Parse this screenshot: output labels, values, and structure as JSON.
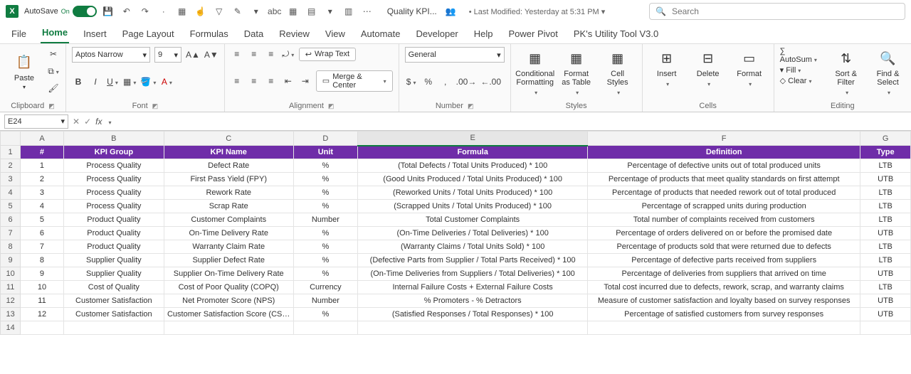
{
  "title": {
    "autosave_label": "AutoSave",
    "autosave_state": "On",
    "doc_name": "Quality KPI...",
    "modified": "• Last Modified: Yesterday at 5:31 PM",
    "search_placeholder": "Search"
  },
  "tabs": {
    "file": "File",
    "home": "Home",
    "insert": "Insert",
    "page_layout": "Page Layout",
    "formulas": "Formulas",
    "data": "Data",
    "review": "Review",
    "view": "View",
    "automate": "Automate",
    "developer": "Developer",
    "help": "Help",
    "power_pivot": "Power Pivot",
    "pk_util": "PK's Utility Tool V3.0"
  },
  "ribbon": {
    "clipboard": {
      "paste": "Paste",
      "label": "Clipboard"
    },
    "font": {
      "name": "Aptos Narrow",
      "size": "9",
      "label": "Font"
    },
    "alignment": {
      "wrap": "Wrap Text",
      "merge": "Merge & Center",
      "label": "Alignment"
    },
    "number": {
      "format": "General",
      "label": "Number"
    },
    "styles": {
      "cond": "Conditional Formatting",
      "table": "Format as Table",
      "cell": "Cell Styles",
      "label": "Styles"
    },
    "cells": {
      "insert": "Insert",
      "delete": "Delete",
      "format": "Format",
      "label": "Cells"
    },
    "editing": {
      "autosum": "AutoSum",
      "fill": "Fill",
      "clear": "Clear",
      "sort": "Sort & Filter",
      "find": "Find & Select",
      "label": "Editing"
    }
  },
  "formula_bar": {
    "name_box": "E24"
  },
  "grid": {
    "columns": [
      "A",
      "B",
      "C",
      "D",
      "E",
      "F",
      "G"
    ],
    "header_row": {
      "A": "#",
      "B": "KPI Group",
      "C": "KPI Name",
      "D": "Unit",
      "E": "Formula",
      "F": "Definition",
      "G": "Type"
    },
    "rows": [
      {
        "n": "1",
        "A": "1",
        "B": "Process Quality",
        "C": "Defect Rate",
        "D": "%",
        "E": "(Total Defects / Total Units Produced) * 100",
        "F": "Percentage of defective units out of total produced units",
        "G": "LTB"
      },
      {
        "n": "2",
        "A": "2",
        "B": "Process Quality",
        "C": "First Pass Yield (FPY)",
        "D": "%",
        "E": "(Good Units Produced / Total Units Produced) * 100",
        "F": "Percentage of products that meet quality standards on first attempt",
        "G": "UTB"
      },
      {
        "n": "3",
        "A": "3",
        "B": "Process Quality",
        "C": "Rework Rate",
        "D": "%",
        "E": "(Reworked Units / Total Units Produced) * 100",
        "F": "Percentage of products that needed rework out of total produced",
        "G": "LTB"
      },
      {
        "n": "4",
        "A": "4",
        "B": "Process Quality",
        "C": "Scrap Rate",
        "D": "%",
        "E": "(Scrapped Units / Total Units Produced) * 100",
        "F": "Percentage of scrapped units during production",
        "G": "LTB"
      },
      {
        "n": "5",
        "A": "5",
        "B": "Product Quality",
        "C": "Customer Complaints",
        "D": "Number",
        "E": "Total Customer Complaints",
        "F": "Total number of complaints received from customers",
        "G": "LTB"
      },
      {
        "n": "6",
        "A": "6",
        "B": "Product Quality",
        "C": "On-Time Delivery Rate",
        "D": "%",
        "E": "(On-Time Deliveries / Total Deliveries) * 100",
        "F": "Percentage of orders delivered on or before the promised date",
        "G": "UTB"
      },
      {
        "n": "7",
        "A": "7",
        "B": "Product Quality",
        "C": "Warranty Claim Rate",
        "D": "%",
        "E": "(Warranty Claims / Total Units Sold) * 100",
        "F": "Percentage of products sold that were returned due to defects",
        "G": "LTB"
      },
      {
        "n": "8",
        "A": "8",
        "B": "Supplier Quality",
        "C": "Supplier Defect Rate",
        "D": "%",
        "E": "(Defective Parts from Supplier / Total Parts Received) * 100",
        "F": "Percentage of defective parts received from suppliers",
        "G": "LTB"
      },
      {
        "n": "9",
        "A": "9",
        "B": "Supplier Quality",
        "C": "Supplier On-Time Delivery Rate",
        "D": "%",
        "E": "(On-Time Deliveries from Suppliers / Total Deliveries) * 100",
        "F": "Percentage of deliveries from suppliers that arrived on time",
        "G": "UTB"
      },
      {
        "n": "10",
        "A": "10",
        "B": "Cost of Quality",
        "C": "Cost of Poor Quality (COPQ)",
        "D": "Currency",
        "E": "Internal Failure Costs + External Failure Costs",
        "F": "Total cost incurred due to defects, rework, scrap, and warranty claims",
        "G": "LTB"
      },
      {
        "n": "11",
        "A": "11",
        "B": "Customer Satisfaction",
        "C": "Net Promoter Score (NPS)",
        "D": "Number",
        "E": "% Promoters - % Detractors",
        "F": "Measure of customer satisfaction and loyalty based on survey responses",
        "G": "UTB"
      },
      {
        "n": "12",
        "A": "12",
        "B": "Customer Satisfaction",
        "C": "Customer Satisfaction Score (CSAT)",
        "D": "%",
        "E": "(Satisfied Responses / Total Responses) * 100",
        "F": "Percentage of satisfied customers from survey responses",
        "G": "UTB"
      }
    ],
    "empty_row": "14"
  }
}
